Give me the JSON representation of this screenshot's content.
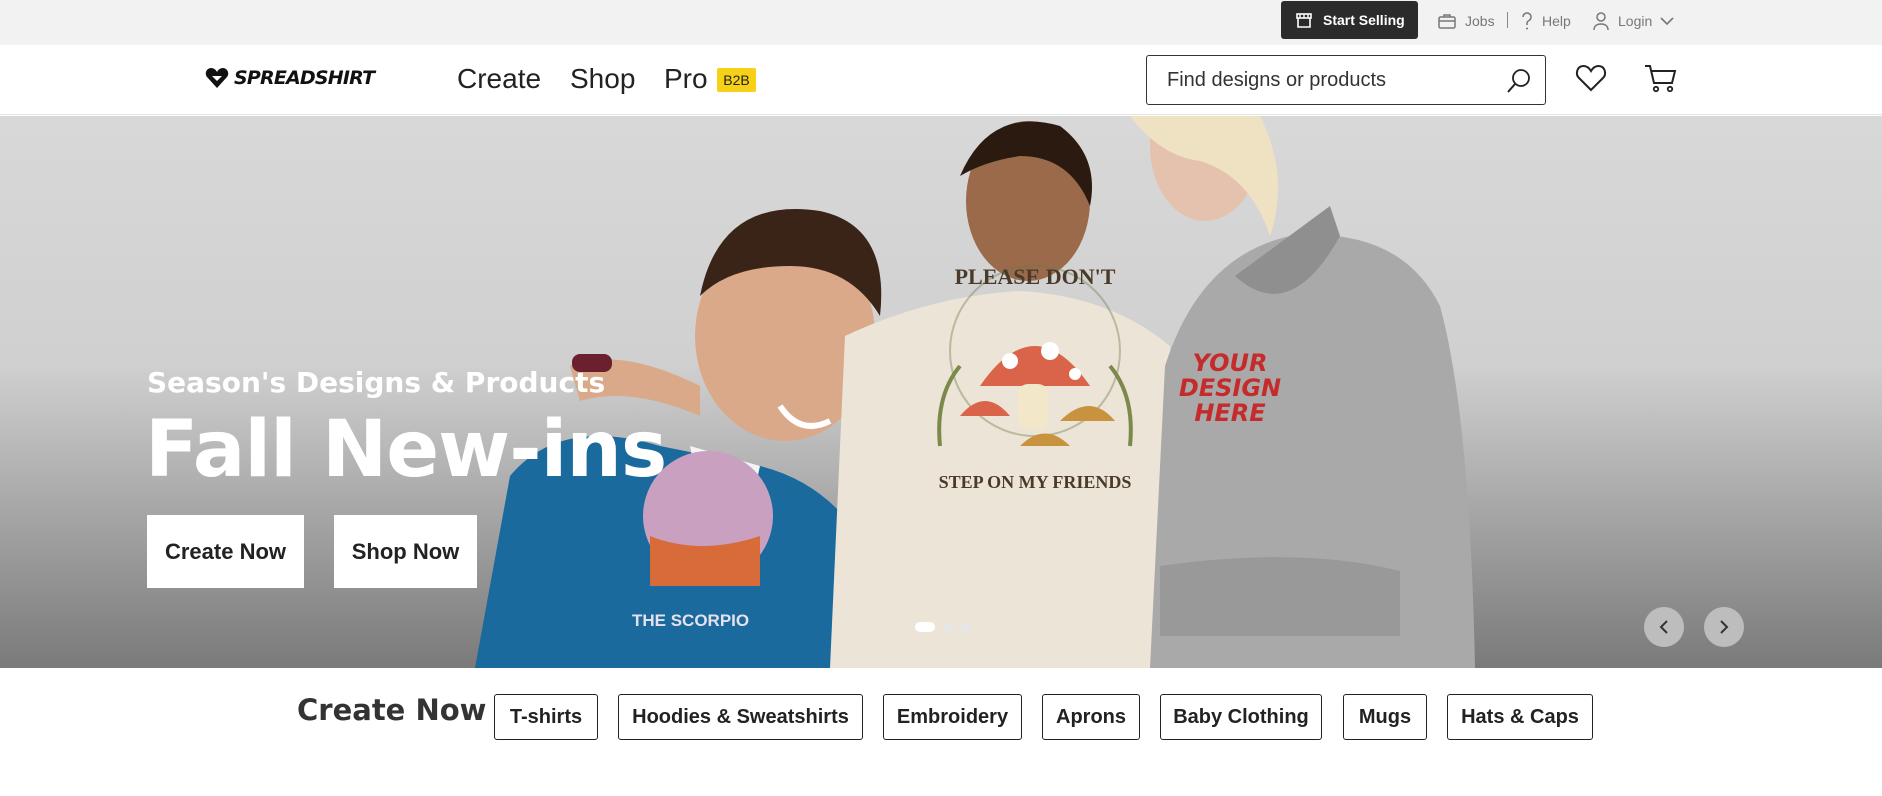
{
  "topbar": {
    "start_selling": "Start Selling",
    "jobs": "Jobs",
    "help": "Help",
    "login": "Login"
  },
  "header": {
    "logo_text": "SPREADSHIRT",
    "nav": [
      {
        "label": "Create"
      },
      {
        "label": "Shop"
      },
      {
        "label": "Pro"
      }
    ],
    "b2b_badge": "B2B",
    "search_placeholder": "Find designs or products"
  },
  "hero": {
    "subtitle": "Season's Designs & Products",
    "title": "Fall New-ins",
    "create_button": "Create Now",
    "shop_button": "Shop Now",
    "slides_total": 3,
    "active_slide": 1,
    "shirt_text_center_top": "PLEASE DON'T",
    "shirt_text_center_bottom": "STEP ON MY FRIENDS",
    "shirt_text_right": [
      "YOUR",
      "DESIGN",
      "HERE"
    ],
    "shirt_text_left": "THE SCORPIO"
  },
  "create_strip": {
    "title": "Create Now",
    "categories": [
      "T-shirts",
      "Hoodies & Sweatshirts",
      "Embroidery",
      "Aprons",
      "Baby Clothing",
      "Mugs",
      "Hats & Caps"
    ]
  },
  "colors": {
    "accent_badge": "#f7d117",
    "dark_button": "#2b2b2b"
  }
}
